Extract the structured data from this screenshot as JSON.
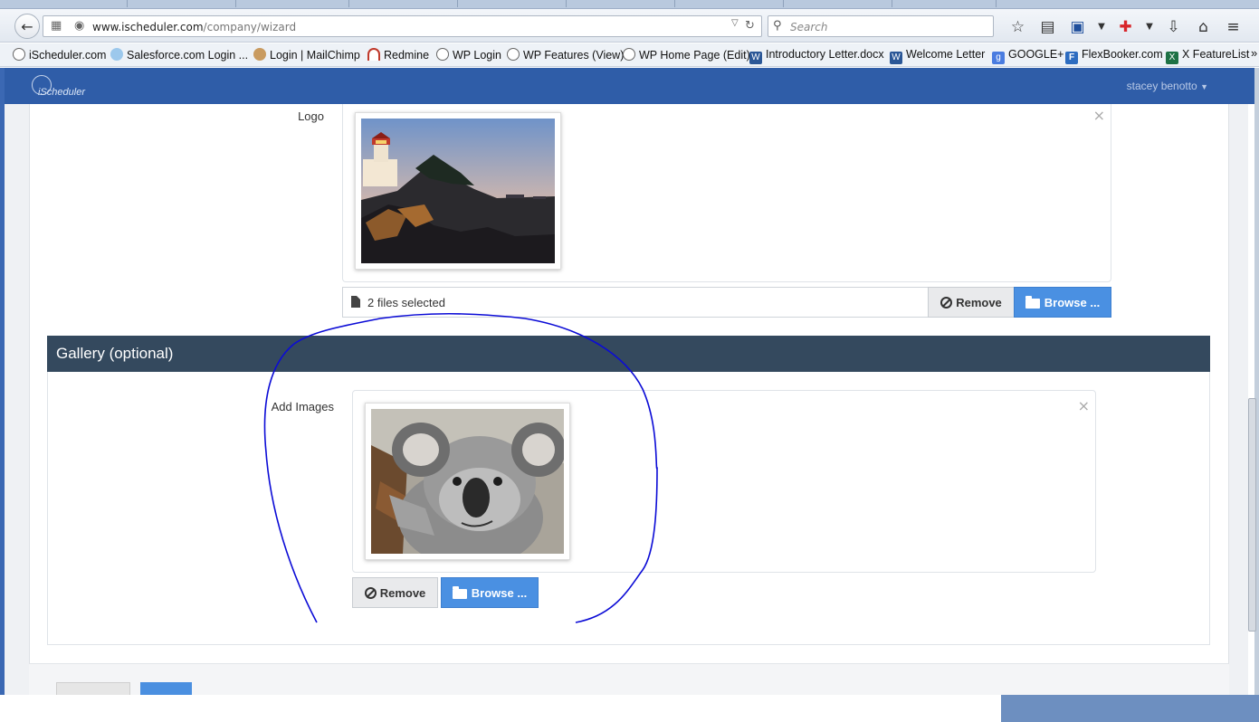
{
  "browser": {
    "url_host": "www.ischeduler.com",
    "url_path": "/company/wizard",
    "search_placeholder": "Search"
  },
  "bookmarks": [
    {
      "label": "iScheduler.com",
      "icon": "clock"
    },
    {
      "label": "Salesforce.com Login ...",
      "icon": "cloud"
    },
    {
      "label": "Login | MailChimp",
      "icon": "mailchimp"
    },
    {
      "label": "Redmine",
      "icon": "redmine"
    },
    {
      "label": "WP Login",
      "icon": "clock"
    },
    {
      "label": "WP Features (View)",
      "icon": "clock"
    },
    {
      "label": "WP Home Page (Edit)",
      "icon": "clock"
    },
    {
      "label": "Introductory Letter.docx",
      "icon": "word"
    },
    {
      "label": "Welcome Letter",
      "icon": "word"
    },
    {
      "label": "GOOGLE+",
      "icon": "google"
    },
    {
      "label": "FlexBooker.com",
      "icon": "fb"
    },
    {
      "label": "X FeatureList",
      "icon": "excel"
    }
  ],
  "bookmarks_overflow": "»",
  "app": {
    "logo_text": "iScheduler",
    "user_menu": "stacey benotto"
  },
  "logo_section": {
    "label": "Logo",
    "files_selected": "2 files selected",
    "remove_label": "Remove",
    "browse_label": "Browse ...",
    "close_symbol": "×"
  },
  "gallery": {
    "title": "Gallery (optional)",
    "label": "Add Images",
    "remove_label": "Remove",
    "browse_label": "Browse ...",
    "close_symbol": "×"
  },
  "annotation_color": "#0b0bd6",
  "colors": {
    "appbar": "#2f5da8",
    "section_header": "#34495e",
    "browse_button": "#4a90e2"
  }
}
